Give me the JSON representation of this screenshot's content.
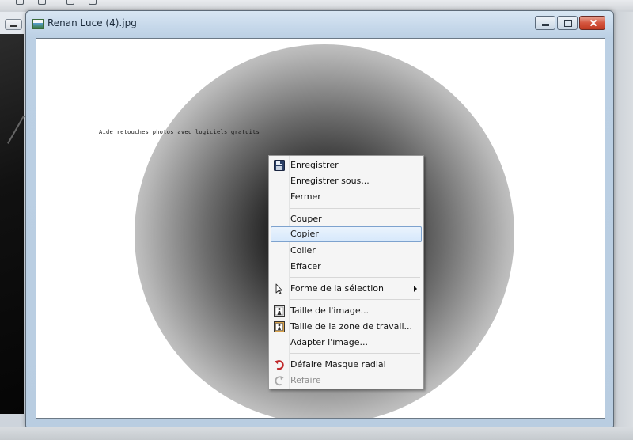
{
  "window": {
    "title": "Renan Luce (4).jpg"
  },
  "canvas": {
    "caption": "Aide retouches photos avec logiciels gratuits"
  },
  "context_menu": {
    "items": [
      {
        "label": "Enregistrer",
        "icon": "floppy-disk-icon",
        "disabled": false
      },
      {
        "label": "Enregistrer sous...",
        "icon": "",
        "disabled": false
      },
      {
        "label": "Fermer",
        "icon": "",
        "disabled": false
      },
      {
        "label": "Couper",
        "icon": "",
        "disabled": false
      },
      {
        "label": "Copier",
        "icon": "",
        "disabled": false,
        "highlighted": true
      },
      {
        "label": "Coller",
        "icon": "",
        "disabled": false
      },
      {
        "label": "Effacer",
        "icon": "",
        "disabled": false
      },
      {
        "label": "Forme de la sélection",
        "icon": "pointer-cursor-icon",
        "disabled": false,
        "has_submenu": true
      },
      {
        "label": "Taille de l'image...",
        "icon": "image-size-icon",
        "disabled": false
      },
      {
        "label": "Taille de la zone de travail...",
        "icon": "canvas-size-icon",
        "disabled": false
      },
      {
        "label": "Adapter l'image...",
        "icon": "",
        "disabled": false
      },
      {
        "label": "Défaire Masque radial",
        "icon": "undo-arrow-icon",
        "disabled": false
      },
      {
        "label": "Refaire",
        "icon": "redo-arrow-icon",
        "disabled": true
      }
    ]
  },
  "colors": {
    "menu_highlight_border": "#7da2ce",
    "undo_icon": "#c0282a",
    "close_button": "#c8452c"
  }
}
